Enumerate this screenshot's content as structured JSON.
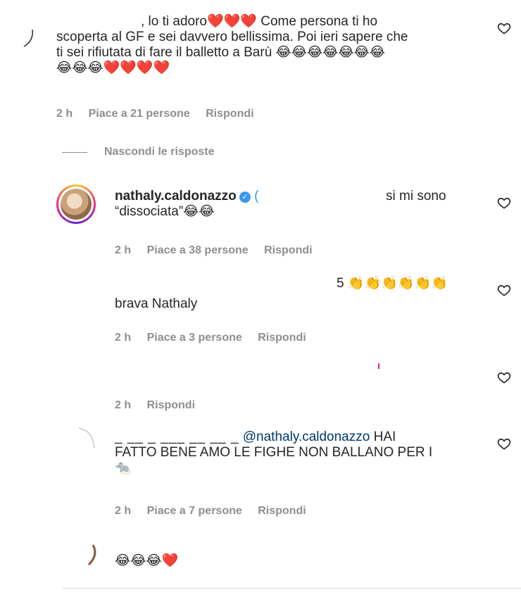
{
  "comments": {
    "c1": {
      "line1": ", lo ti adoro❤️❤️❤️ Come persona ti ho",
      "line2": "scoperta al GF e sei davvero bellissima. Poi ieri sapere che",
      "line3": "ti sei rifiutata di fare il balletto a Barù 😂😂😂😂😂😂😂",
      "line4": "😂😂😂❤️❤️❤️❤️",
      "time": "2 h",
      "likes": "Piace a 21 persone",
      "reply": "Rispondi"
    },
    "toggle_replies": "Nascondi le risposte",
    "r1": {
      "username": "nathaly.caldonazzo",
      "verified_glyph": "✓",
      "partial": "(",
      "text_tail": "si mi sono",
      "line2": "“dissociata”😂😂",
      "time": "2 h",
      "likes": "Piace a 38 persone",
      "reply": "Rispondi"
    },
    "r2": {
      "top": "5 👏👏👏👏👏👏",
      "text": "brava Nathaly",
      "time": "2 h",
      "likes": "Piace a 3 persone",
      "reply": "Rispondi"
    },
    "r3": {
      "time": "2 h",
      "reply": "Rispondi"
    },
    "r4": {
      "partial": "_ __ _ ___ __ __ _",
      "mention": "@nathaly.caldonazzo",
      "line1_tail": " HAI",
      "line2": "FATTO BENE AMO LE FIGHE NON BALLANO PER I",
      "line3": "🐀",
      "time": "2 h",
      "likes": "Piace a 7 persone",
      "reply": "Rispondi"
    },
    "r5": {
      "text": "😂😂😂❤️"
    }
  },
  "icons": {
    "like": "heart-outline-icon",
    "verified": "verified-badge-icon"
  },
  "colors": {
    "text": "#262626",
    "meta": "#8e8e8e",
    "mention": "#00376b",
    "verified": "#3897f0"
  }
}
